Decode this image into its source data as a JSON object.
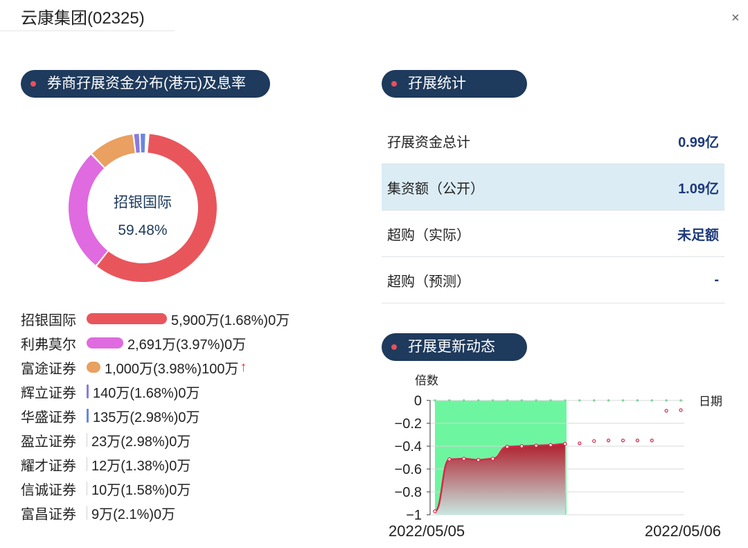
{
  "window": {
    "title": "云康集团(02325)",
    "close_label": "×"
  },
  "distribution": {
    "section_title": "券商孖展资金分布(港元)及息率",
    "donut_center_name": "招银国际",
    "donut_center_percent": "59.48%",
    "brokers": [
      {
        "name": "招银国际",
        "value_text": "5,900万(1.68%)0万",
        "share": 0.5948,
        "color": "#e8565c",
        "up": false
      },
      {
        "name": "利弗莫尔",
        "value_text": "2,691万(3.97%)0万",
        "share": 0.2713,
        "color": "#e06ae0",
        "up": false
      },
      {
        "name": "富途证券",
        "value_text": "1,000万(3.98%)100万",
        "share": 0.1008,
        "color": "#e9a060",
        "up": true
      },
      {
        "name": "辉立证券",
        "value_text": "140万(1.68%)0万",
        "share": 0.0141,
        "color": "#8a7ae0",
        "up": false
      },
      {
        "name": "华盛证券",
        "value_text": "135万(2.98%)0万",
        "share": 0.0136,
        "color": "#6a86e0",
        "up": false
      },
      {
        "name": "盈立证券",
        "value_text": "23万(2.98%)0万",
        "share": 0.0023,
        "color": "#c8c8c8",
        "up": false
      },
      {
        "name": "耀才证券",
        "value_text": "12万(1.38%)0万",
        "share": 0.0012,
        "color": "#c8c8c8",
        "up": false
      },
      {
        "name": "信诚证券",
        "value_text": "10万(1.58%)0万",
        "share": 0.001,
        "color": "#c8c8c8",
        "up": false
      },
      {
        "name": "富昌证券",
        "value_text": "9万(2.1%)0万",
        "share": 0.0009,
        "color": "#c8c8c8",
        "up": false
      }
    ],
    "up_arrow": "↑"
  },
  "stats": {
    "section_title": "孖展统计",
    "rows": [
      {
        "label": "孖展资金总计",
        "value": "0.99亿"
      },
      {
        "label": "集资额（公开）",
        "value": "1.09亿"
      },
      {
        "label": "超购（实际）",
        "value": "未足额"
      },
      {
        "label": "超购（预测）",
        "value": "-"
      }
    ]
  },
  "updates": {
    "section_title": "孖展更新动态",
    "chart_data": {
      "type": "line",
      "ylabel": "倍数",
      "xlabel": "日期",
      "ylim": [
        -1,
        0
      ],
      "yticks": [
        "0",
        "−0.2",
        "−0.4",
        "−0.6",
        "−0.8",
        "−1"
      ],
      "x_start_label": "2022/05/05",
      "x_end_label": "2022/05/06",
      "highlight_range": [
        0,
        9
      ],
      "grid": true,
      "series": [
        {
          "values": [
            -0.97,
            -0.515,
            -0.51,
            -0.52,
            -0.51,
            -0.405,
            -0.4,
            -0.395,
            -0.39,
            -0.38,
            -0.375,
            -0.355,
            -0.35,
            -0.35,
            -0.35,
            -0.35,
            -0.09,
            -0.085
          ]
        }
      ],
      "line_color": "#d6274a",
      "highlight_color": "#6ef5a0"
    }
  }
}
